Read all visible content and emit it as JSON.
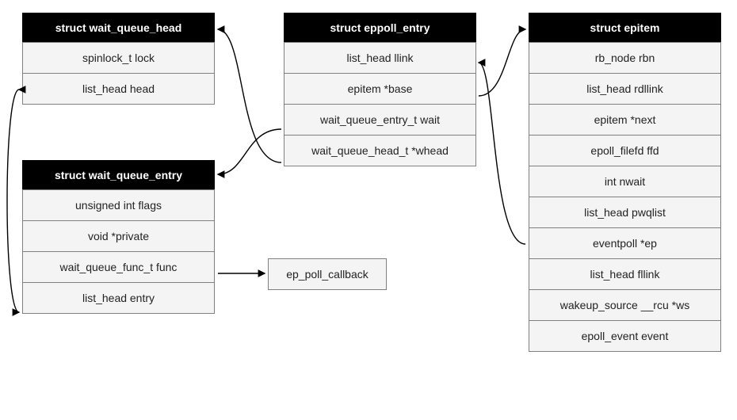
{
  "wait_queue_head": {
    "title": "struct wait_queue_head",
    "fields": [
      "spinlock_t lock",
      "list_head head"
    ]
  },
  "wait_queue_entry": {
    "title": "struct wait_queue_entry",
    "fields": [
      "unsigned int flags",
      "void *private",
      "wait_queue_func_t func",
      "list_head entry"
    ]
  },
  "eppoll_entry": {
    "title": "struct eppoll_entry",
    "fields": [
      "list_head llink",
      "epitem *base",
      "wait_queue_entry_t wait",
      "wait_queue_head_t *whead"
    ]
  },
  "epitem": {
    "title": "struct epitem",
    "fields": [
      "rb_node rbn",
      "list_head rdllink",
      "epitem *next",
      "epoll_filefd ffd",
      "int nwait",
      "list_head pwqlist",
      "eventpoll *ep",
      "list_head fllink",
      "wakeup_source __rcu *ws",
      "epoll_event event"
    ]
  },
  "callback": {
    "label": "ep_poll_callback"
  }
}
